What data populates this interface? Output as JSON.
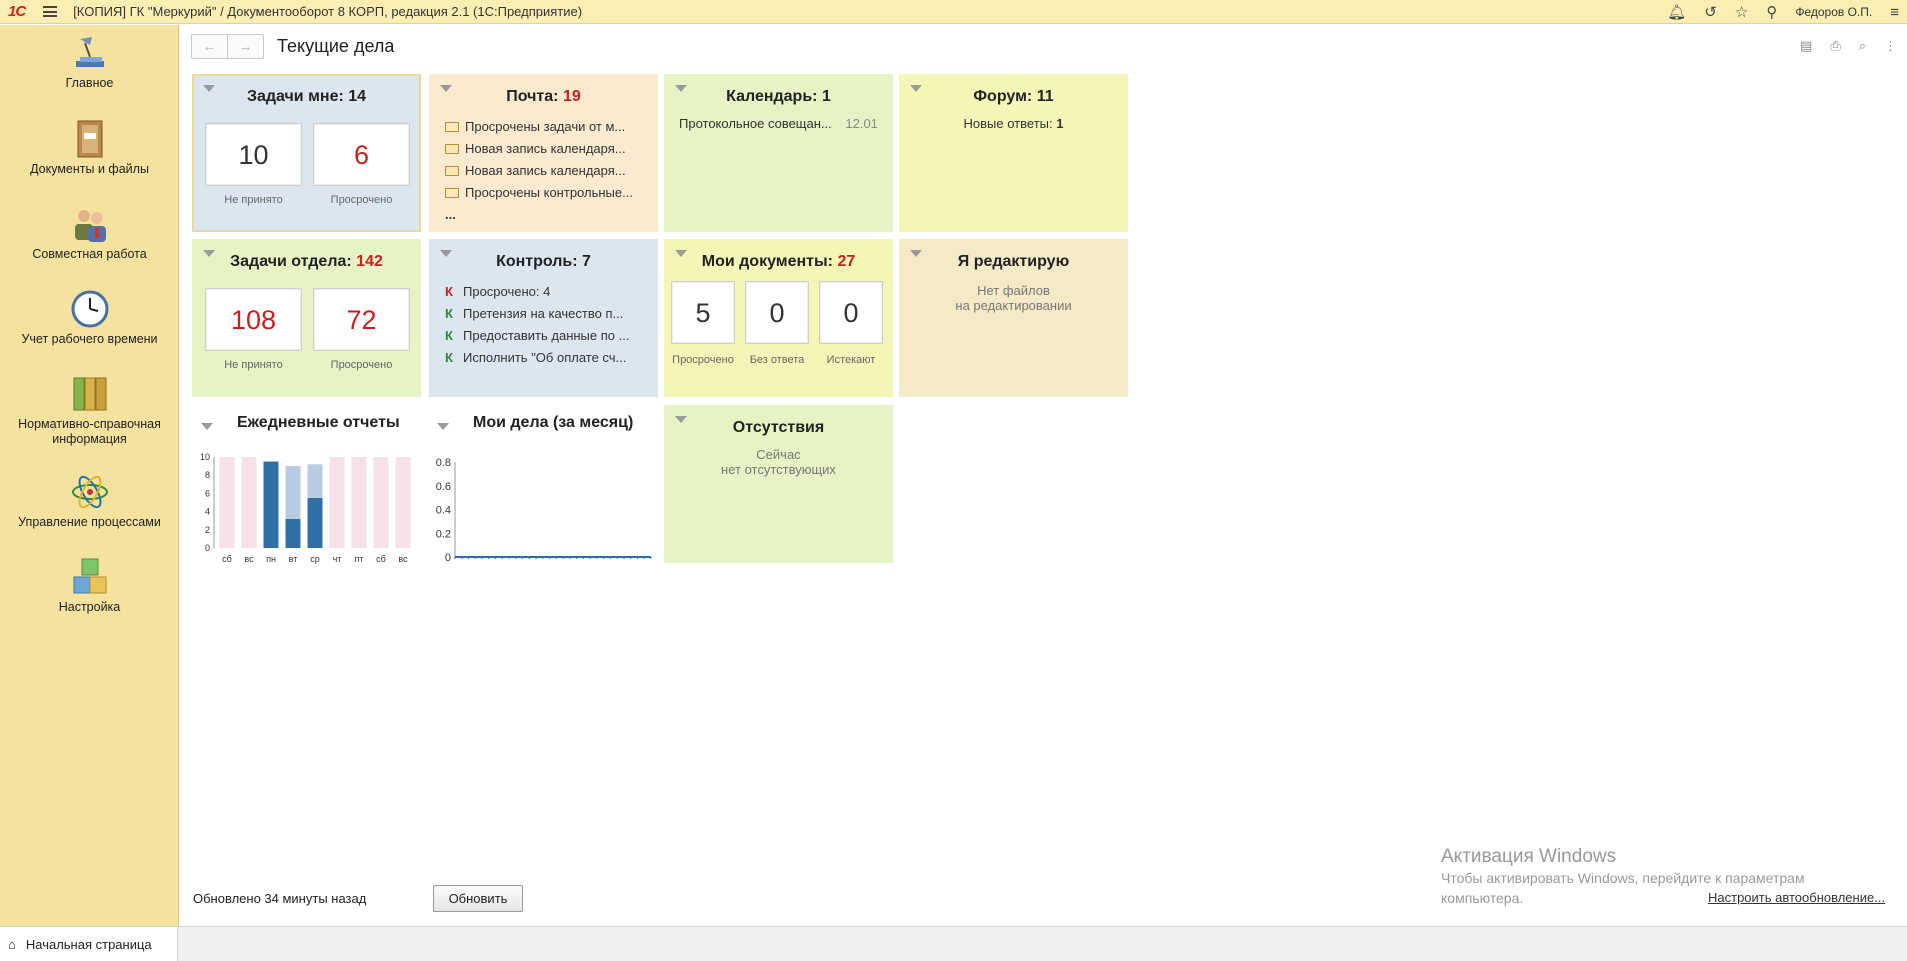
{
  "window": {
    "logo": "1С",
    "title": "[КОПИЯ] ГК \"Меркурий\" / Документооборот 8 КОРП, редакция 2.1  (1С:Предприятие)",
    "user": "Федоров О.П."
  },
  "sidebar": {
    "items": [
      {
        "label": "Главное",
        "icon": "desk-lamp-icon"
      },
      {
        "label": "Документы и файлы",
        "icon": "binder-icon"
      },
      {
        "label": "Совместная работа",
        "icon": "people-icon"
      },
      {
        "label": "Учет рабочего времени",
        "icon": "clock-icon"
      },
      {
        "label": "Нормативно-справочная информация",
        "icon": "folders-icon"
      },
      {
        "label": "Управление процессами",
        "icon": "atom-icon"
      },
      {
        "label": "Настройка",
        "icon": "cubes-icon"
      }
    ]
  },
  "page": {
    "title": "Текущие дела",
    "back": "←",
    "forward": "→"
  },
  "tiles": {
    "my_tasks": {
      "title": "Задачи мне:",
      "count": "14",
      "not_accepted": "10",
      "not_accepted_label": "Не принято",
      "overdue": "6",
      "overdue_label": "Просрочено"
    },
    "mail": {
      "title": "Почта:",
      "count": "19",
      "items": [
        "Просрочены задачи от м...",
        "Новая запись календаря...",
        "Новая запись календаря...",
        "Просрочены контрольные..."
      ],
      "more": "..."
    },
    "calendar": {
      "title": "Календарь:",
      "count": "1",
      "item": "Протокольное совещан...",
      "item_date": "12.01"
    },
    "forum": {
      "title": "Форум:",
      "count": "11",
      "new_label": "Новые ответы:",
      "new_count": "1"
    },
    "dept_tasks": {
      "title": "Задачи отдела:",
      "count": "142",
      "not_accepted": "108",
      "not_accepted_label": "Не принято",
      "overdue": "72",
      "overdue_label": "Просрочено"
    },
    "control": {
      "title": "Контроль:",
      "count": "7",
      "items": [
        {
          "mark": "К",
          "text": "Просрочено: 4",
          "color": "#c8201d"
        },
        {
          "mark": "К",
          "text": "Претензия на качество п...",
          "color": "#2e8b3a"
        },
        {
          "mark": "К",
          "text": "Предоставить данные по ...",
          "color": "#2e8b3a"
        },
        {
          "mark": "К",
          "text": "Исполнить \"Об оплате сч...",
          "color": "#2e8b3a"
        }
      ]
    },
    "my_docs": {
      "title": "Мои документы:",
      "count": "27",
      "overdue": "5",
      "overdue_label": "Просрочено",
      "no_answer": "0",
      "no_answer_label": "Без ответа",
      "expiring": "0",
      "expiring_label": "Истекают"
    },
    "editing": {
      "title": "Я редактирую",
      "line1": "Нет файлов",
      "line2": "на редактировании"
    },
    "absences": {
      "title": "Отсутствия",
      "line1": "Сейчас",
      "line2": "нет отсутствующих"
    }
  },
  "chart_data": [
    {
      "type": "bar",
      "title": "Ежедневные отчеты",
      "categories": [
        "сб",
        "вс",
        "пн",
        "вт",
        "ср",
        "чт",
        "пт",
        "сб",
        "вс"
      ],
      "series": [
        {
          "values": [
            0,
            0,
            9.5,
            3.2,
            5.5,
            0,
            0,
            0,
            0
          ]
        },
        {
          "values": [
            0,
            0,
            0,
            5.8,
            3.7,
            0,
            0,
            0,
            0
          ]
        }
      ],
      "background_bars": [
        true,
        true,
        false,
        false,
        false,
        true,
        true,
        true,
        true
      ],
      "ylim": [
        0,
        10
      ],
      "yticks": [
        "10",
        "8",
        "6",
        "4",
        "2",
        "0"
      ]
    },
    {
      "type": "line",
      "title": "Мои дела (за месяц)",
      "ylim": [
        0,
        0.8
      ],
      "yticks": [
        "0.8",
        "0.6",
        "0.4",
        "0.2",
        "0"
      ],
      "values": [
        0,
        0,
        0,
        0,
        0,
        0,
        0,
        0,
        0,
        0,
        0,
        0,
        0,
        0,
        0,
        0,
        0,
        0,
        0,
        0,
        0,
        0,
        0,
        0,
        0,
        0,
        0,
        0,
        0,
        0
      ]
    }
  ],
  "footer": {
    "updated": "Обновлено 34 минуты назад",
    "refresh": "Обновить"
  },
  "windows_activation": {
    "title": "Активация Windows",
    "line1": "Чтобы активировать Windows, перейдите к параметрам",
    "line2": "компьютера.",
    "link": "Настроить автообновление..."
  },
  "tabs": {
    "home": "Начальная страница"
  },
  "colors": {
    "accent_red": "#c8201d",
    "sidebar": "#f5e29f",
    "bar_dark": "#2f6ea7",
    "bar_light": "#b8cbe0",
    "bar_bg": "#f6e1e6"
  }
}
